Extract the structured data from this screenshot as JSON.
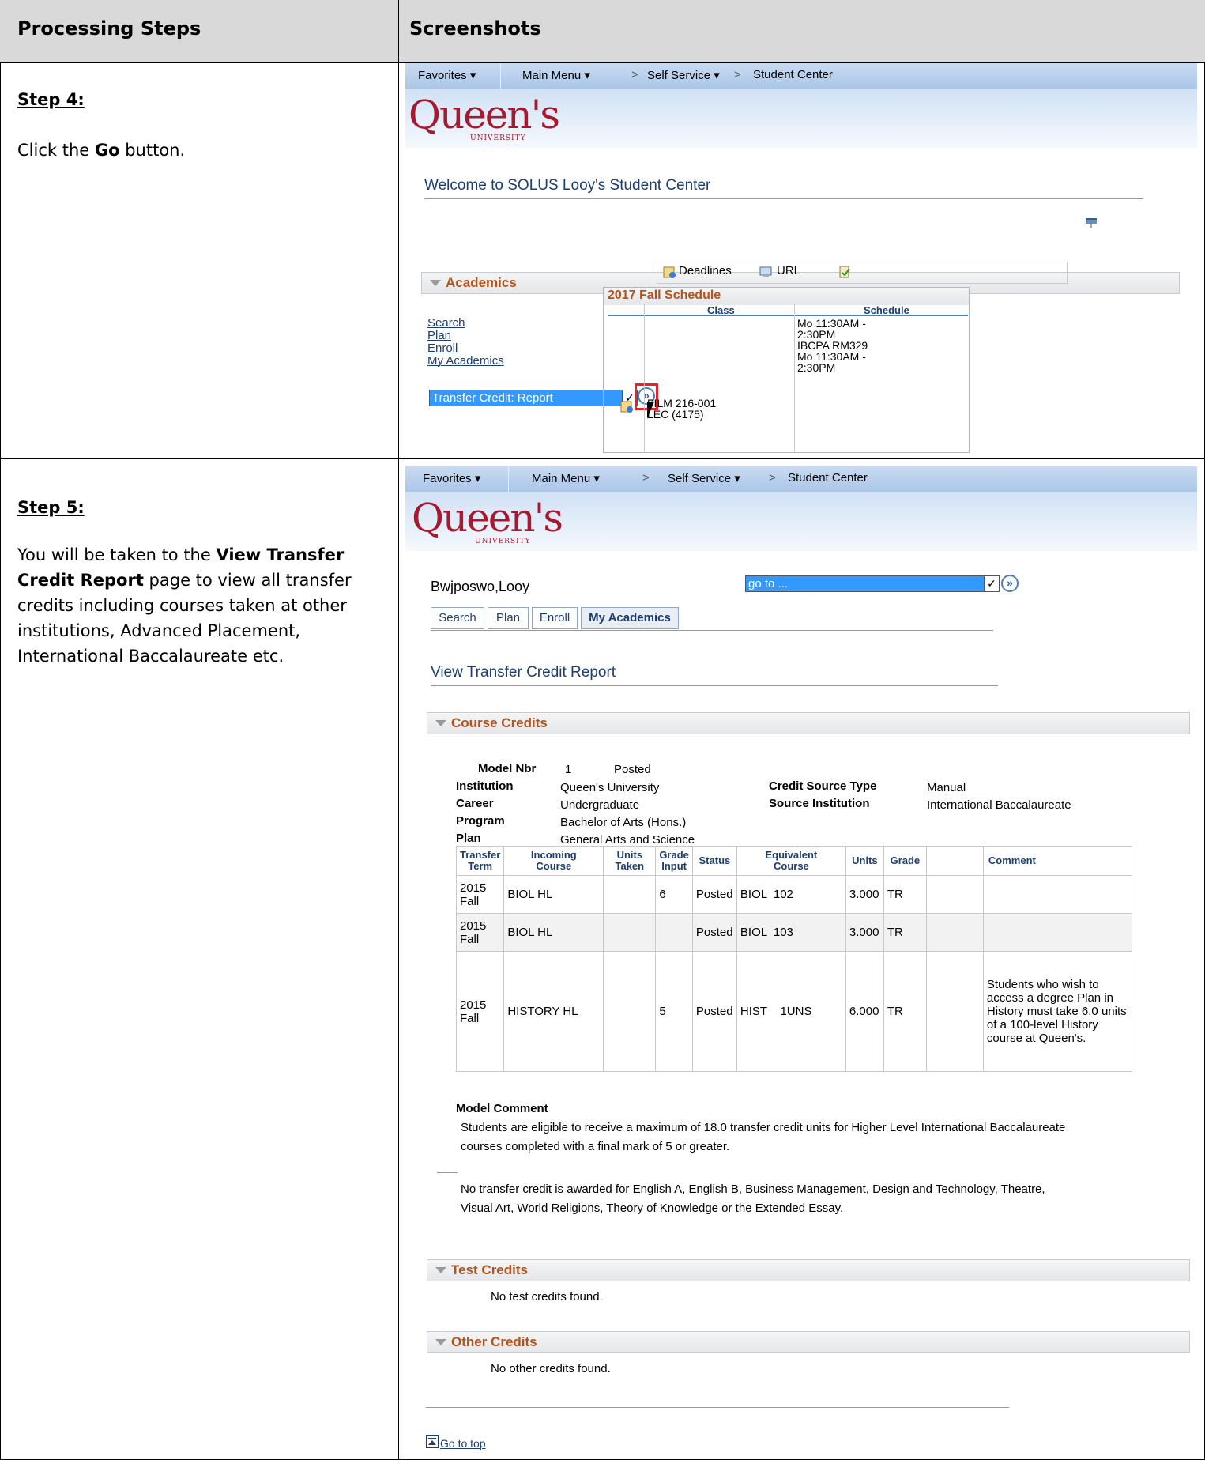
{
  "header": {
    "col1": "Processing Steps",
    "col2": "Screenshots"
  },
  "step4": {
    "title": "Step 4:",
    "text_pre": "Click the ",
    "text_bold": "Go",
    "text_post": " button."
  },
  "step5": {
    "title": "Step 5:",
    "line1_pre": "You will be taken to the ",
    "line1_bold": "View Transfer",
    "line2_bold": "Credit Report",
    "line2_post": " page to view all transfer",
    "line3": "credits including courses taken at other",
    "line4": "institutions, Advanced Placement,",
    "line5": "International Baccalaureate etc."
  },
  "nav": {
    "favorites": "Favorites ▾",
    "main_menu": "Main Menu ▾",
    "self_service": "Self Service ▾",
    "student_center": "Student Center",
    "sep": ">"
  },
  "logo": {
    "main": "Queen's",
    "sub": "UNIVERSITY"
  },
  "shot1": {
    "welcome": "Welcome to SOLUS Looy's Student Center",
    "section": "Academics",
    "links": [
      "Search",
      "Plan",
      "Enroll",
      "My Academics"
    ],
    "dropdown_value": "Transfer Credit: Report",
    "toolbar": {
      "deadlines": "Deadlines",
      "url": "URL"
    },
    "schedule_title": "2017 Fall Schedule",
    "col_class": "Class",
    "col_schedule": "Schedule",
    "class_line1": "FILM 216-001",
    "class_line2": "LEC (4175)",
    "sched_lines": [
      "Mo 11:30AM -",
      "2:30PM",
      "IBCPA RM329",
      "Mo 11:30AM -",
      "2:30PM"
    ]
  },
  "shot2": {
    "student_name": "Bwjposwo,Looy",
    "goto_value": "go to ...",
    "tabs": [
      "Search",
      "Plan",
      "Enroll",
      "My Academics"
    ],
    "page_title": "View Transfer Credit Report",
    "course_credits": "Course Credits",
    "model_nbr_label": "Model Nbr",
    "model_nbr": "1",
    "model_status": "Posted",
    "institution_label": "Institution",
    "institution": "Queen's University",
    "career_label": "Career",
    "career": "Undergraduate",
    "program_label": "Program",
    "program": "Bachelor of Arts (Hons.)",
    "plan_label": "Plan",
    "plan": "General Arts and Science",
    "credit_source_label": "Credit Source Type",
    "credit_source": "Manual",
    "source_inst_label": "Source Institution",
    "source_inst": "International Baccalaureate",
    "columns": [
      "Transfer Term",
      "Incoming Course",
      "Units Taken",
      "Grade Input",
      "Status",
      "Equivalent Course",
      "Units",
      "Grade",
      "",
      "Comment"
    ],
    "rows": [
      {
        "term": "2015 Fall",
        "course": "BIOL HL",
        "units_taken": "",
        "grade_input": "6",
        "status": "Posted",
        "equiv": "BIOL  102",
        "units": "3.000",
        "grade": "TR",
        "comment": ""
      },
      {
        "term": "2015 Fall",
        "course": "BIOL HL",
        "units_taken": "",
        "grade_input": "",
        "status": "Posted",
        "equiv": "BIOL  103",
        "units": "3.000",
        "grade": "TR",
        "comment": ""
      },
      {
        "term": "2015 Fall",
        "course": "HISTORY HL",
        "units_taken": "",
        "grade_input": "5",
        "status": "Posted",
        "equiv": "HIST    1UNS",
        "units": "6.000",
        "grade": "TR",
        "comment": "Students who wish to access a degree Plan in History must take 6.0 units of a 100-level History course at Queen's."
      }
    ],
    "model_comment_label": "Model Comment",
    "model_comment_1": "Students are eligible to receive a maximum of 18.0 transfer credit units for Higher Level International Baccalaureate",
    "model_comment_2": "courses completed with a final mark of 5 or greater.",
    "note_1": "No transfer credit is awarded for English A, English B, Business Management, Design and Technology, Theatre,",
    "note_2": "Visual Art, World Religions, Theory of Knowledge or the Extended Essay.",
    "test_credits": "Test Credits",
    "test_none": "No test credits found.",
    "other_credits": "Other Credits",
    "other_none": "No other credits found.",
    "go_top": "Go to top"
  }
}
